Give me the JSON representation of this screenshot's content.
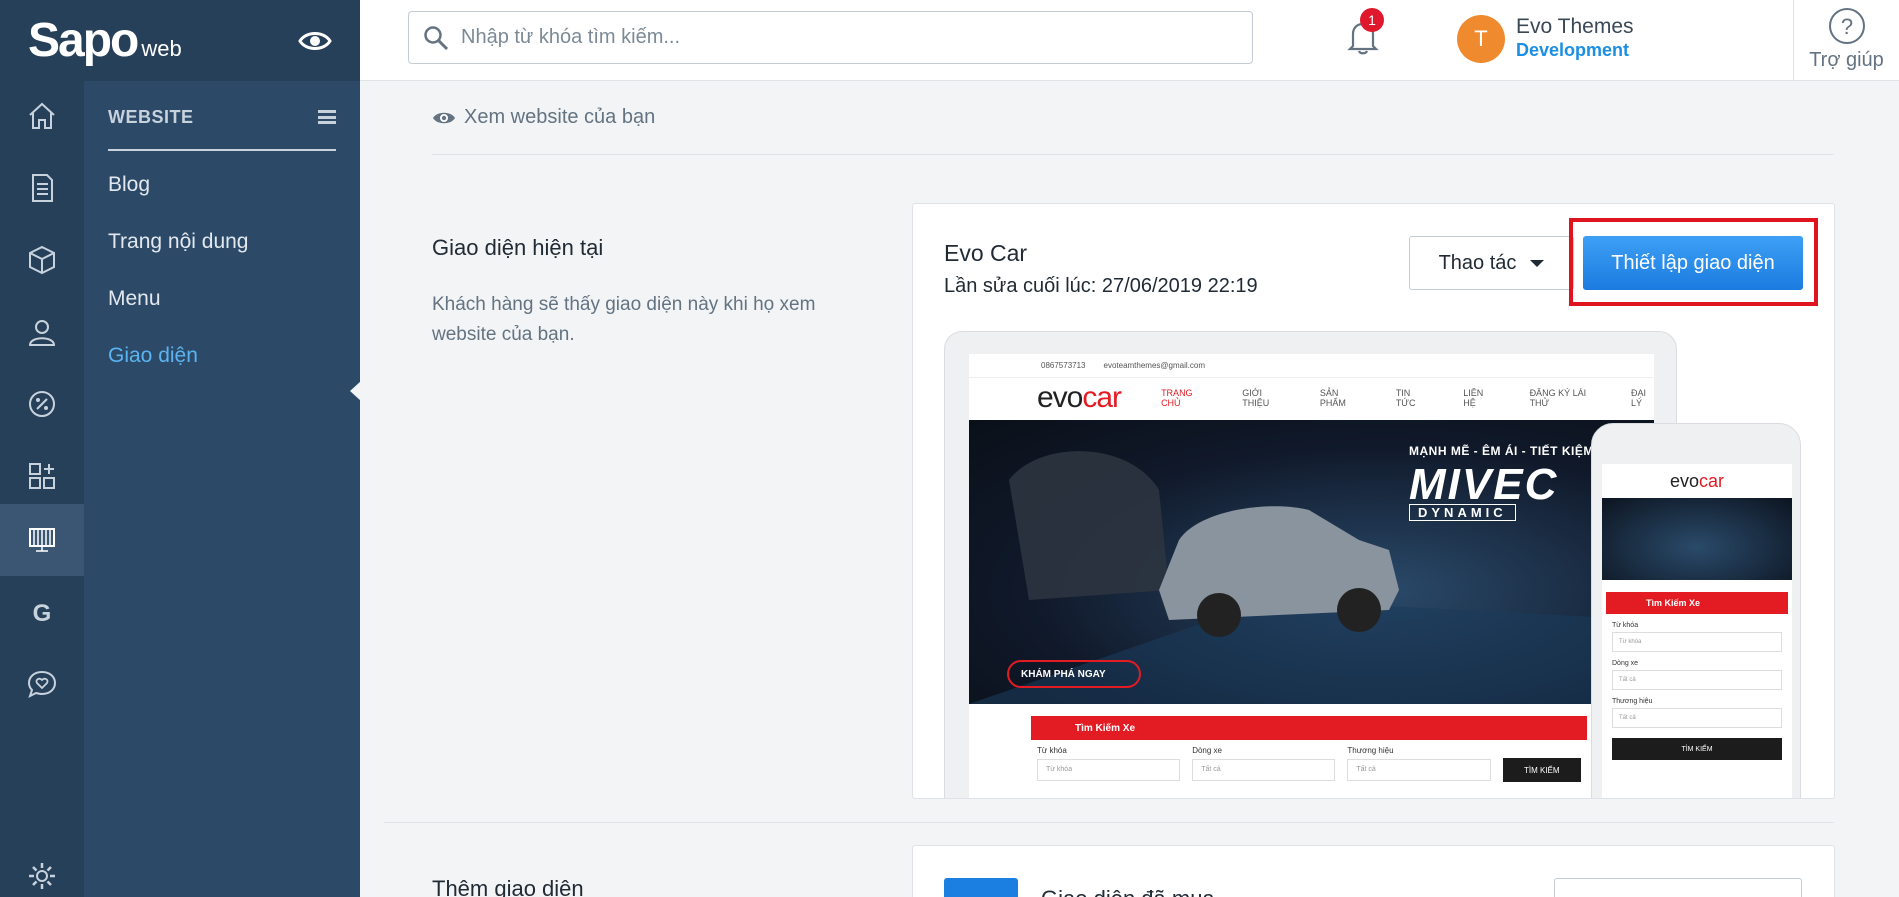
{
  "brand": {
    "logo": "Sapo",
    "suffix": "web"
  },
  "search": {
    "placeholder": "Nhập từ khóa tìm kiếm..."
  },
  "notifications": {
    "count": "1"
  },
  "user": {
    "initial": "T",
    "name": "Evo Themes",
    "status": "Development"
  },
  "help": {
    "label": "Trợ giúp"
  },
  "rail": {
    "items": [
      "home-icon",
      "orders-icon",
      "products-icon",
      "customers-icon",
      "promotions-icon",
      "apps-icon",
      "website-icon",
      "google-icon",
      "support-icon",
      "settings-icon"
    ],
    "active": "website-icon"
  },
  "sidebar": {
    "heading": "WEBSITE",
    "items": [
      {
        "label": "Blog"
      },
      {
        "label": "Trang nội dung"
      },
      {
        "label": "Menu"
      },
      {
        "label": "Giao diện",
        "active": true
      }
    ]
  },
  "main": {
    "view_site": "Xem website của bạn",
    "current": {
      "title": "Giao diện hiện tại",
      "description": "Khách hàng sẽ thấy giao diện này khi họ xem website của bạn.",
      "theme_name": "Evo Car",
      "last_modified": "Lần sửa cuối lúc: 27/06/2019 22:19",
      "action_label": "Thao tác",
      "setup_label": "Thiết lập giao diện"
    },
    "add": {
      "title": "Thêm giao diện",
      "purchased_label": "Giao diện đã mua"
    }
  },
  "preview": {
    "phone": "0867573713",
    "email": "evoteamthemes@gmail.com",
    "logo_a": "evo",
    "logo_b": "car",
    "menu": [
      "TRANG CHỦ",
      "GIỚI THIỆU",
      "SẢN PHẨM",
      "TIN TỨC",
      "LIÊN HỆ",
      "ĐĂNG KÝ LÁI THỬ",
      "ĐẠI LÝ"
    ],
    "hero_tagline": "MẠNH MẼ - ÊM ÁI - TIẾT KIỆM",
    "hero_title": "MIVEC",
    "hero_sub": "DYNAMIC",
    "hero_button": "KHÁM PHÁ NGAY",
    "search_title": "Tìm Kiếm Xe",
    "field_keyword": "Từ khóa",
    "field_keyword_ph": "Từ khóa",
    "field_line": "Dòng xe",
    "field_brand": "Thương hiệu",
    "field_all": "Tất cả",
    "search_button": "TÌM KIẾM"
  },
  "colors": {
    "rail": "#27405a",
    "sidebar": "#2c4a68",
    "accent": "#1a8fe3",
    "highlight": "#e0141e",
    "brand_red": "#e31b23"
  }
}
